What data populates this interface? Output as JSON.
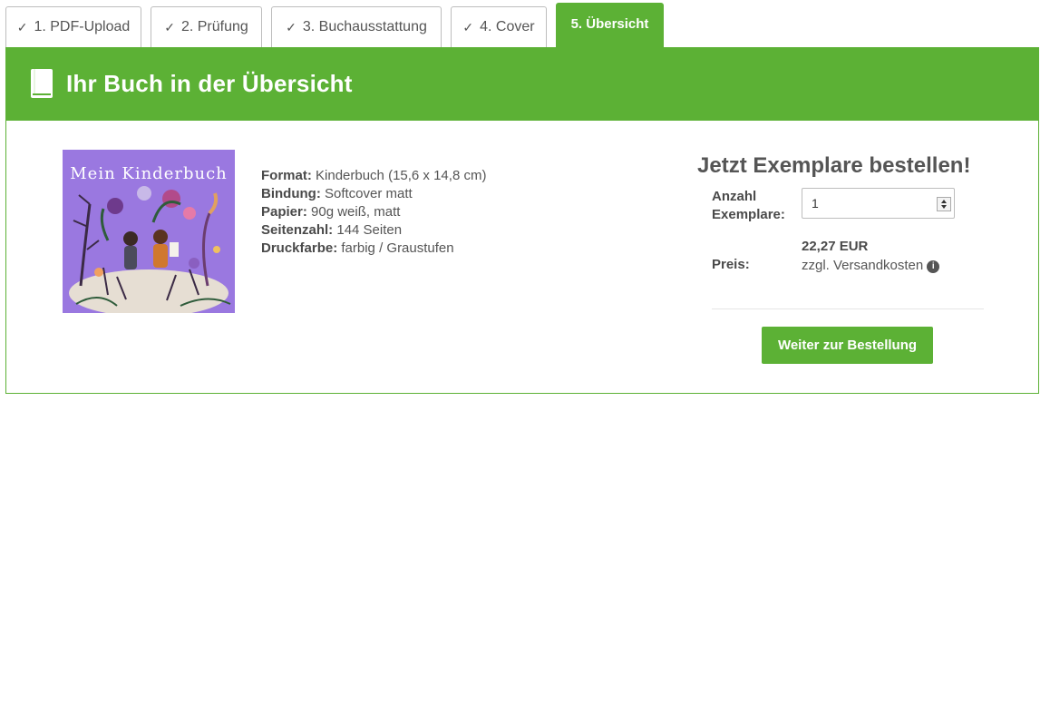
{
  "tabs": [
    {
      "label": "1. PDF-Upload",
      "done": true
    },
    {
      "label": "2. Prüfung",
      "done": true
    },
    {
      "label": "3. Buchausstattung",
      "done": true
    },
    {
      "label": "4. Cover",
      "done": true
    },
    {
      "label": "5. Übersicht",
      "active": true
    }
  ],
  "header": {
    "title": "Ihr Buch in der Übersicht",
    "icon": "book-icon"
  },
  "cover": {
    "title": "Mein Kinderbuch"
  },
  "specs": [
    {
      "label": "Format:",
      "value": "Kinderbuch (15,6 x 14,8 cm)"
    },
    {
      "label": "Bindung:",
      "value": "Softcover matt"
    },
    {
      "label": "Papier:",
      "value": "90g weiß, matt"
    },
    {
      "label": "Seitenzahl:",
      "value": "144 Seiten"
    },
    {
      "label": "Druckfarbe:",
      "value": "farbig / Graustufen"
    }
  ],
  "order": {
    "title": "Jetzt Exemplare bestellen!",
    "quantity_label": "Anzahl Exemplare:",
    "quantity_value": "1",
    "price_label": "Preis:",
    "price": "22,27 EUR",
    "price_note": "zzgl. Versandkosten",
    "button": "Weiter zur Bestellung"
  },
  "colors": {
    "accent": "#5cb135",
    "cover_bg": "#9a78e0"
  }
}
